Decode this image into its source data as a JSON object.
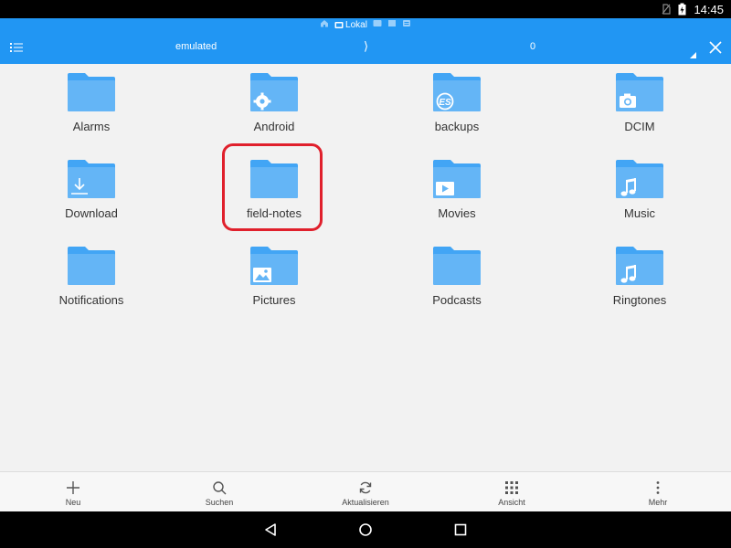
{
  "status_bar": {
    "time": "14:45"
  },
  "breadcrumb": {
    "active_label": "Lokal"
  },
  "app_bar": {
    "path": "emulated",
    "separator": "⟩",
    "count": "0"
  },
  "folders": [
    {
      "name": "Alarms",
      "overlay": "none"
    },
    {
      "name": "Android",
      "overlay": "gear-icon"
    },
    {
      "name": "backups",
      "overlay": "es-logo-icon"
    },
    {
      "name": "DCIM",
      "overlay": "camera-icon"
    },
    {
      "name": "Download",
      "overlay": "download-icon"
    },
    {
      "name": "field-notes",
      "overlay": "none",
      "highlighted": true
    },
    {
      "name": "Movies",
      "overlay": "play-icon"
    },
    {
      "name": "Music",
      "overlay": "music-note-icon"
    },
    {
      "name": "Notifications",
      "overlay": "none"
    },
    {
      "name": "Pictures",
      "overlay": "image-icon"
    },
    {
      "name": "Podcasts",
      "overlay": "none"
    },
    {
      "name": "Ringtones",
      "overlay": "music-note-icon"
    }
  ],
  "toolbar": {
    "new_label": "Neu",
    "search_label": "Suchen",
    "refresh_label": "Aktualisieren",
    "view_label": "Ansicht",
    "more_label": "Mehr"
  },
  "colors": {
    "accent": "#2196f3",
    "folder_body": "#64b5f6",
    "folder_tab": "#42a5f5",
    "highlight": "#e0202c"
  }
}
